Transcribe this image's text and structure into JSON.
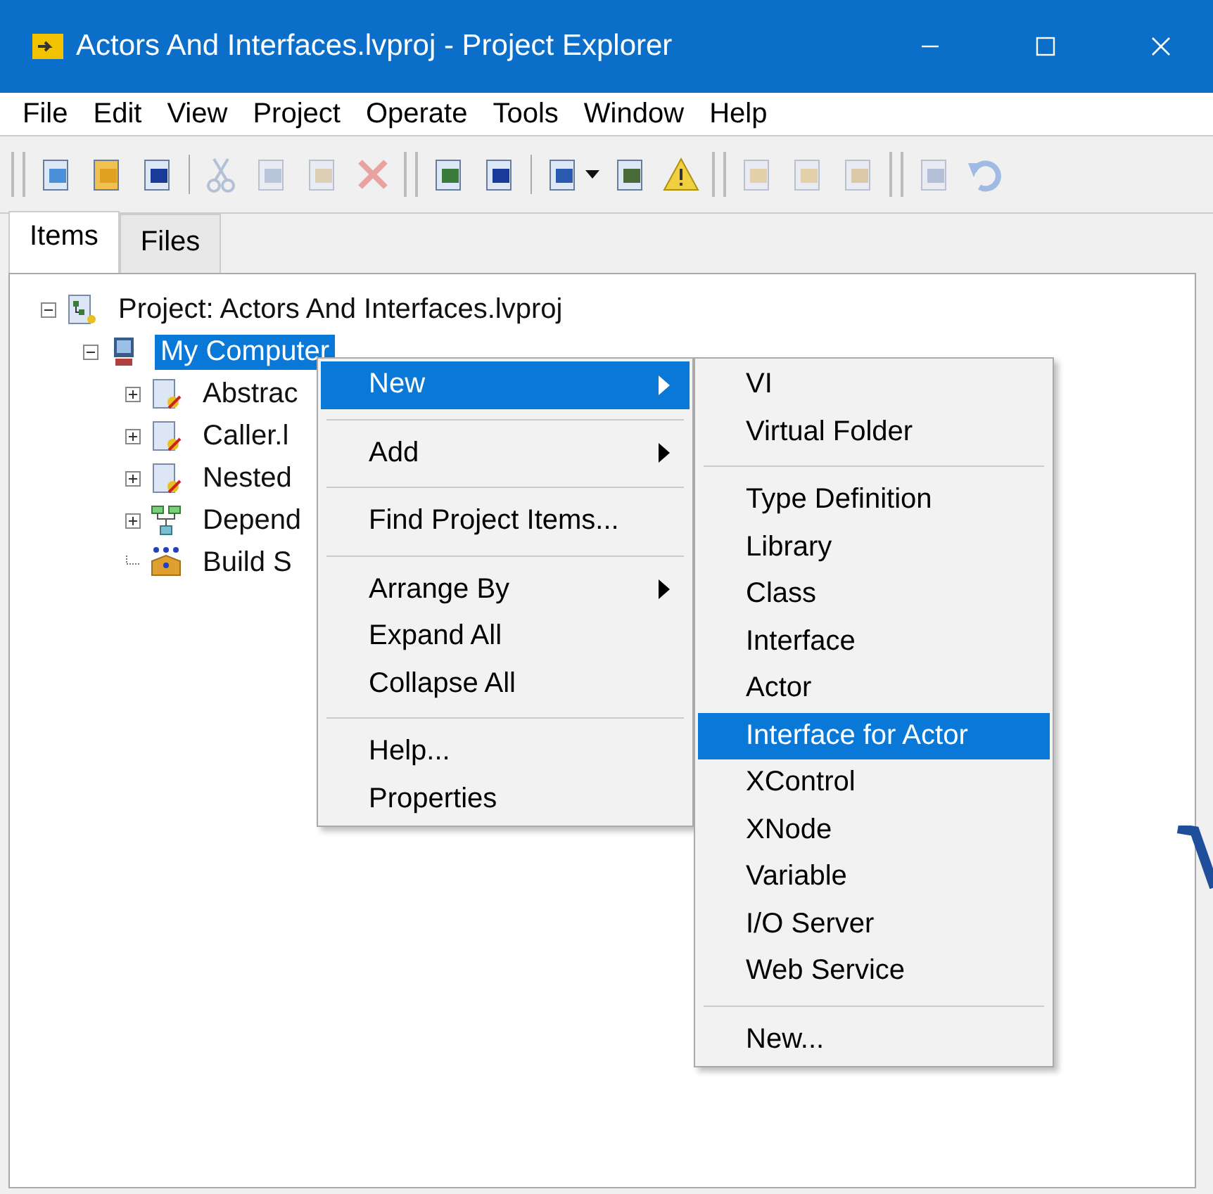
{
  "window": {
    "title": "Actors And Interfaces.lvproj - Project Explorer"
  },
  "menu_bar": [
    "File",
    "Edit",
    "View",
    "Project",
    "Operate",
    "Tools",
    "Window",
    "Help"
  ],
  "toolbar": [
    {
      "kind": "grip"
    },
    {
      "kind": "new",
      "disabled": false
    },
    {
      "kind": "open",
      "disabled": false
    },
    {
      "kind": "save-all",
      "disabled": false
    },
    {
      "kind": "sep"
    },
    {
      "kind": "cut",
      "disabled": true
    },
    {
      "kind": "copy",
      "disabled": true
    },
    {
      "kind": "paste",
      "disabled": true
    },
    {
      "kind": "delete",
      "disabled": true
    },
    {
      "kind": "grip"
    },
    {
      "kind": "project-new",
      "disabled": false
    },
    {
      "kind": "project-save",
      "disabled": false
    },
    {
      "kind": "sep"
    },
    {
      "kind": "view",
      "disabled": false
    },
    {
      "kind": "dropdown",
      "disabled": false
    },
    {
      "kind": "hierarchy",
      "disabled": false
    },
    {
      "kind": "warning",
      "disabled": false
    },
    {
      "kind": "grip"
    },
    {
      "kind": "build",
      "disabled": true
    },
    {
      "kind": "package",
      "disabled": true
    },
    {
      "kind": "deploy",
      "disabled": true
    },
    {
      "kind": "grip"
    },
    {
      "kind": "check",
      "disabled": true
    },
    {
      "kind": "undo",
      "disabled": true
    }
  ],
  "tabs": [
    {
      "label": "Items",
      "selected": true
    },
    {
      "label": "Files",
      "selected": false
    }
  ],
  "tree": [
    {
      "label": "Project: Actors And Interfaces.lvproj",
      "kind": "project",
      "expanded": true,
      "selected": false,
      "children": [
        {
          "label": "My Computer",
          "kind": "computer",
          "expanded": true,
          "selected": true,
          "children": [
            {
              "label": "Abstrac",
              "kind": "library",
              "expanded": false,
              "selected": false
            },
            {
              "label": "Caller.l",
              "kind": "library",
              "expanded": false,
              "selected": false
            },
            {
              "label": "Nested",
              "kind": "library",
              "expanded": false,
              "selected": false
            },
            {
              "label": "Depend",
              "kind": "dependencies",
              "expanded": false,
              "selected": false
            },
            {
              "label": "Build S",
              "kind": "build",
              "selected": false
            }
          ]
        }
      ]
    }
  ],
  "context_menu": [
    {
      "kind": "item",
      "label": "New",
      "submenu": true,
      "selected": true
    },
    {
      "kind": "separator"
    },
    {
      "kind": "item",
      "label": "Add",
      "submenu": true,
      "selected": false
    },
    {
      "kind": "separator"
    },
    {
      "kind": "item",
      "label": "Find Project Items...",
      "submenu": false,
      "selected": false
    },
    {
      "kind": "separator"
    },
    {
      "kind": "item",
      "label": "Arrange By",
      "submenu": true,
      "selected": false
    },
    {
      "kind": "item",
      "label": "Expand All",
      "submenu": false,
      "selected": false
    },
    {
      "kind": "item",
      "label": "Collapse All",
      "submenu": false,
      "selected": false
    },
    {
      "kind": "separator"
    },
    {
      "kind": "item",
      "label": "Help...",
      "submenu": false,
      "selected": false
    },
    {
      "kind": "item",
      "label": "Properties",
      "submenu": false,
      "selected": false
    }
  ],
  "submenu": [
    {
      "kind": "item",
      "label": "VI",
      "selected": false
    },
    {
      "kind": "item",
      "label": "Virtual Folder",
      "selected": false
    },
    {
      "kind": "separator"
    },
    {
      "kind": "item",
      "label": "Type Definition",
      "selected": false
    },
    {
      "kind": "item",
      "label": "Library",
      "selected": false
    },
    {
      "kind": "item",
      "label": "Class",
      "selected": false
    },
    {
      "kind": "item",
      "label": "Interface",
      "selected": false
    },
    {
      "kind": "item",
      "label": "Actor",
      "selected": false
    },
    {
      "kind": "item",
      "label": "Interface for Actor",
      "selected": true
    },
    {
      "kind": "item",
      "label": "XControl",
      "selected": false
    },
    {
      "kind": "item",
      "label": "XNode",
      "selected": false
    },
    {
      "kind": "item",
      "label": "Variable",
      "selected": false
    },
    {
      "kind": "item",
      "label": "I/O Server",
      "selected": false
    },
    {
      "kind": "item",
      "label": "Web Service",
      "selected": false
    },
    {
      "kind": "separator"
    },
    {
      "kind": "item",
      "label": "New...",
      "selected": false
    }
  ]
}
